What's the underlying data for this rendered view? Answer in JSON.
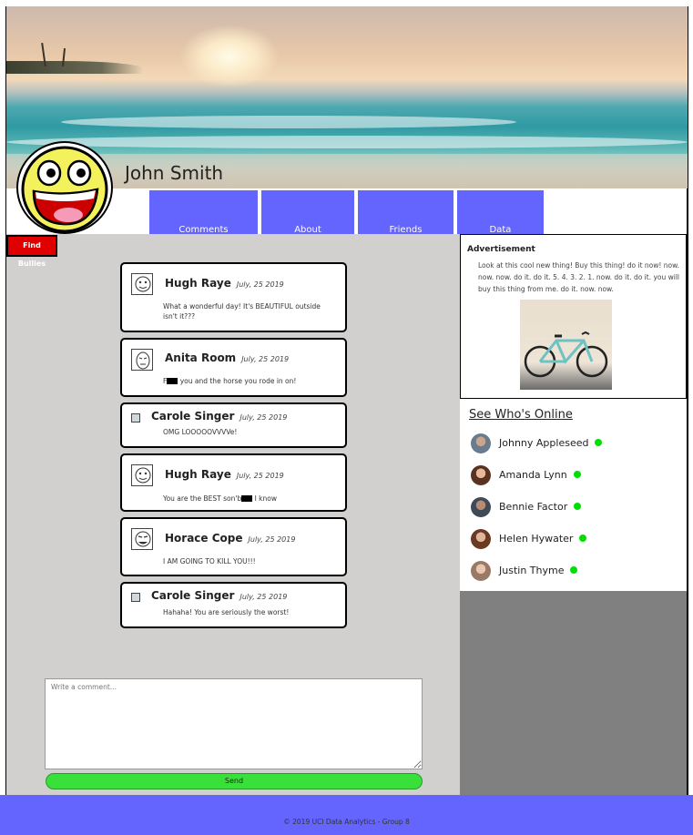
{
  "profile": {
    "name": "John Smith"
  },
  "nav": {
    "tabs": [
      "Comments",
      "About",
      "Friends",
      "Data"
    ]
  },
  "find_bullies_label": "Find Bullies",
  "posts": [
    {
      "author": "Hugh Raye",
      "date": "July, 25 2019",
      "text": "What a wonderful day! It's BEAUTIFUL outside isn't it???"
    },
    {
      "author": "Anita Room",
      "date": "July, 25 2019",
      "text_before": "F",
      "text_after": " you and the horse you rode in on!"
    },
    {
      "author": "Carole Singer",
      "date": "July, 25 2019",
      "text": "OMG LOOOOOVVVVe!"
    },
    {
      "author": "Hugh Raye",
      "date": "July, 25 2019",
      "text_before": "You are the BEST son'b",
      "text_after": " I know"
    },
    {
      "author": "Horace Cope",
      "date": "July, 25 2019",
      "text": "I AM GOING TO KILL YOU!!!"
    },
    {
      "author": "Carole Singer",
      "date": "July, 25 2019",
      "text": "Hahaha! You are seriously the worst!"
    }
  ],
  "comment": {
    "placeholder": "Write a comment...",
    "send_label": "Send"
  },
  "ad": {
    "title": "Advertisement",
    "text": "Look at this cool new thing! Buy this thing! do it now! now. now. now. do it. do it. 5. 4. 3. 2. 1. now. do it. do it. you will buy this thing from me. do it. now. now."
  },
  "online": {
    "title": "See Who's Online",
    "users": [
      "Johnny Appleseed",
      "Amanda Lynn",
      "Bennie Factor",
      "Helen Hywater",
      "Justin Thyme"
    ]
  },
  "footer": {
    "text": "© 2019 UCI Data Analytics - Group 8"
  },
  "colors": {
    "accent": "#6464ff",
    "send": "#39e03a",
    "alert": "#e00000",
    "online": "#00e000"
  }
}
